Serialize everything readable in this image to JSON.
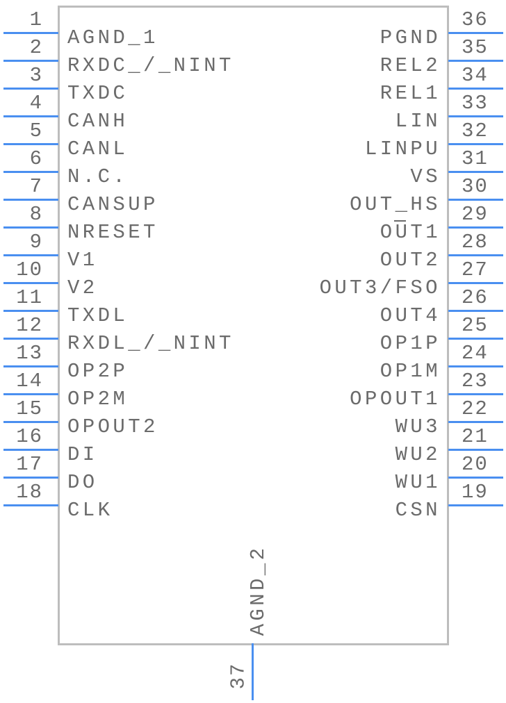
{
  "colors": {
    "pin": "#4a8ff0",
    "body_outline": "#bdbdbd",
    "text": "#6b6b6b"
  },
  "left_pins": [
    {
      "num": "1",
      "label": "AGND_1"
    },
    {
      "num": "2",
      "label": "RXDC_/_NINT"
    },
    {
      "num": "3",
      "label": "TXDC"
    },
    {
      "num": "4",
      "label": "CANH"
    },
    {
      "num": "5",
      "label": "CANL"
    },
    {
      "num": "6",
      "label": "N.C."
    },
    {
      "num": "7",
      "label": "CANSUP"
    },
    {
      "num": "8",
      "label": "NRESET"
    },
    {
      "num": "9",
      "label": "V1"
    },
    {
      "num": "10",
      "label": "V2"
    },
    {
      "num": "11",
      "label": "TXDL"
    },
    {
      "num": "12",
      "label": "RXDL_/_NINT"
    },
    {
      "num": "13",
      "label": "OP2P"
    },
    {
      "num": "14",
      "label": "OP2M"
    },
    {
      "num": "15",
      "label": "OPOUT2"
    },
    {
      "num": "16",
      "label": "DI"
    },
    {
      "num": "17",
      "label": "DO"
    },
    {
      "num": "18",
      "label": "CLK"
    }
  ],
  "right_pins": [
    {
      "num": "36",
      "label": "PGND"
    },
    {
      "num": "35",
      "label": "REL2"
    },
    {
      "num": "34",
      "label": "REL1"
    },
    {
      "num": "33",
      "label": "LIN"
    },
    {
      "num": "32",
      "label": "LINPU"
    },
    {
      "num": "31",
      "label": "VS"
    },
    {
      "num": "30",
      "label": "OUT_HS"
    },
    {
      "num": "29",
      "label": "OUT1",
      "overline": "U"
    },
    {
      "num": "28",
      "label": "OUT2"
    },
    {
      "num": "27",
      "label": "OUT3/FSO"
    },
    {
      "num": "26",
      "label": "OUT4"
    },
    {
      "num": "25",
      "label": "OP1P"
    },
    {
      "num": "24",
      "label": "OP1M"
    },
    {
      "num": "23",
      "label": "OPOUT1"
    },
    {
      "num": "22",
      "label": "WU3"
    },
    {
      "num": "21",
      "label": "WU2"
    },
    {
      "num": "20",
      "label": "WU1"
    },
    {
      "num": "19",
      "label": "CSN"
    }
  ],
  "bottom_pin": {
    "num": "37",
    "label": "AGND_2"
  }
}
